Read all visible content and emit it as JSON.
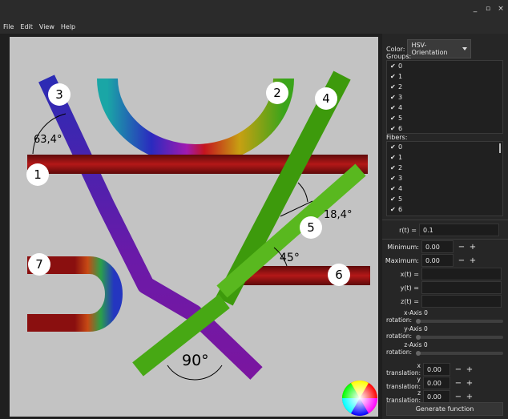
{
  "window": {
    "controls": [
      "_",
      "▫",
      "×"
    ]
  },
  "menu": [
    "File",
    "Edit",
    "View",
    "Help"
  ],
  "scene": {
    "angle_labels": [
      "63,4°",
      "18,4°",
      "45°",
      "90°"
    ],
    "fiber_labels": [
      "1",
      "2",
      "3",
      "4",
      "5",
      "6",
      "7"
    ],
    "colors": {
      "red": "#8c0f0f",
      "blue": "#121a8c",
      "green": "#3d9a0c",
      "background": "#c3c3c3"
    }
  },
  "panel": {
    "color_label": "Color:",
    "color_value": "HSV-Orientation",
    "groups_label": "Groups:",
    "groups": [
      "0",
      "1",
      "2",
      "3",
      "4",
      "5",
      "6"
    ],
    "fibers_label": "Fibers:",
    "fibers": [
      "0",
      "1",
      "2",
      "3",
      "4",
      "5",
      "6"
    ],
    "check": "✔",
    "r_label": "r(t) =",
    "r_value": "0.1",
    "minimum_label": "Minimum:",
    "minimum_value": "0.00",
    "maximum_label": "Maximum:",
    "maximum_value": "0.00",
    "x_label": "x(t) =",
    "y_label": "y(t) =",
    "z_label": "z(t) =",
    "x_axis_label": "x-Axis 0",
    "y_axis_label": "y-Axis 0",
    "z_axis_label": "z-Axis 0",
    "rotation_label": "rotation:",
    "x_trans_label": "x translation:",
    "x_trans_value": "0.00",
    "y_trans_label": "y translation:",
    "y_trans_value": "0.00",
    "z_trans_label": "z translation:",
    "z_trans_value": "0.00",
    "minus": "−",
    "plus": "+",
    "generate": "Generate function"
  }
}
